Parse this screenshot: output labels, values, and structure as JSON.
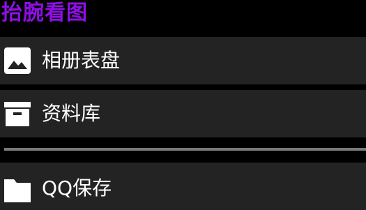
{
  "app": {
    "title": "抬腕看图",
    "accent_color": "#8f0fe6"
  },
  "menu": {
    "items": [
      {
        "label": "相册表盘",
        "icon": "image-icon"
      },
      {
        "label": "资料库",
        "icon": "archive-box-icon"
      },
      {
        "label": "QQ保存",
        "icon": "folder-icon"
      }
    ]
  }
}
